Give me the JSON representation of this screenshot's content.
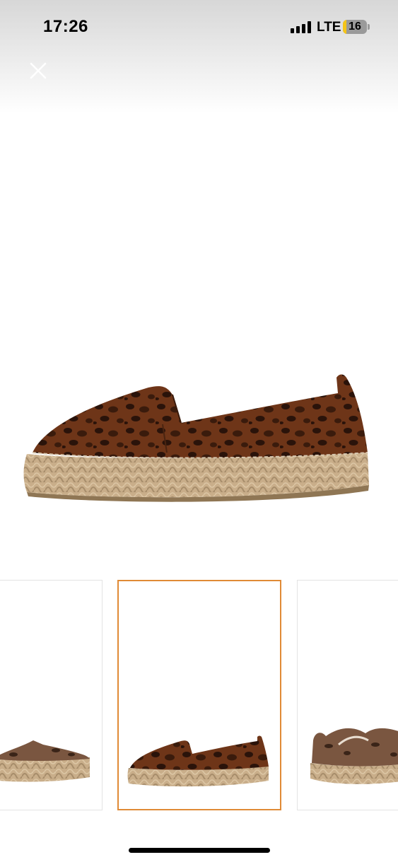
{
  "status_bar": {
    "time": "17:26",
    "network": "LTE",
    "battery_level": "16",
    "battery_color": "#f5c518"
  },
  "viewer": {
    "close_icon": "close-icon",
    "selected_thumbnail_index": 1,
    "selected_border_color": "#e08a36",
    "thumbnails": [
      {
        "name": "thumbnail-1",
        "view": "side-toe-left"
      },
      {
        "name": "thumbnail-2",
        "view": "side-toe-left-full"
      },
      {
        "name": "thumbnail-3",
        "view": "pair-angled"
      }
    ]
  }
}
